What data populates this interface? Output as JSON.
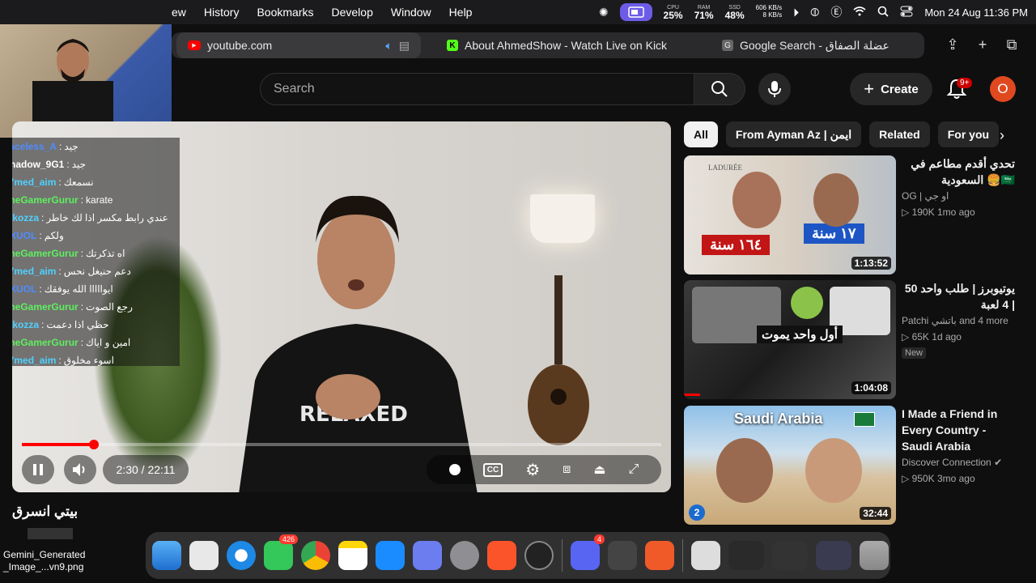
{
  "menubar": {
    "menus": [
      "ew",
      "History",
      "Bookmarks",
      "Develop",
      "Window",
      "Help"
    ],
    "cpu_label": "CPU",
    "cpu_value": "25%",
    "ram_label": "RAM",
    "ram_value": "71%",
    "ssd_label": "SSD",
    "ssd_value": "48%",
    "net_up": "606 KB/s",
    "net_down": "8 KB/s",
    "clock": "Mon 24 Aug  11:36 PM"
  },
  "tabs": [
    {
      "label": "youtube.com"
    },
    {
      "label": "About AhmedShow - Watch Live on Kick"
    },
    {
      "label": "Google Search - عضلة الصفاق"
    }
  ],
  "header": {
    "search_placeholder": "Search",
    "create_label": "Create",
    "notif_count": "9+",
    "avatar_letter": "O"
  },
  "chat": [
    {
      "user": "Faceless_A",
      "msg": "جيد",
      "color": "#4f8bff"
    },
    {
      "user": "Shadow_9G1",
      "msg": "جيد",
      "color": "#ffffff"
    },
    {
      "user": "a7med_aim",
      "msg": "نسمعك",
      "color": "#4fd0ff"
    },
    {
      "user": "TheGamerGurur",
      "msg": "karate",
      "color": "#5ef05e"
    },
    {
      "user": "rakozza",
      "msg": "عندي رابط مكسر اذا لك خاطر",
      "color": "#4fd0ff"
    },
    {
      "user": "EXUOL",
      "msg": "ولكم",
      "color": "#4f8bff"
    },
    {
      "user": "TheGamerGurur",
      "msg": "اه تذكرتك",
      "color": "#5ef05e"
    },
    {
      "user": "a7med_aim",
      "msg": "دعم حنيغل نحس",
      "color": "#4fd0ff"
    },
    {
      "user": "EXUOL",
      "msg": "ايوااااا الله يوفقك",
      "color": "#4f8bff"
    },
    {
      "user": "TheGamerGurur",
      "msg": "رجع الصوت",
      "color": "#5ef05e"
    },
    {
      "user": "rakozza",
      "msg": "حظي اذا دعمت",
      "color": "#4fd0ff"
    },
    {
      "user": "TheGamerGurur",
      "msg": "امين و اياك",
      "color": "#5ef05e"
    },
    {
      "user": "a7med_aim",
      "msg": "اسوء مخلوق",
      "color": "#4fd0ff"
    }
  ],
  "player": {
    "time": "2:30 / 22:11",
    "progress": 0.113,
    "caption": "بيتي انسرق"
  },
  "chips": [
    "All",
    "From Ayman Az | ايمن",
    "Related",
    "For you"
  ],
  "recommendations": [
    {
      "title": "تحدي أقدم مطاعم في السعودية 🍔🇸🇦",
      "channel": "OG | او جي",
      "views": "190K",
      "age": "1mo ago",
      "duration": "1:13:52",
      "thumb_text_left": "١٦٤ سنة",
      "thumb_text_right": "١٧ سنة",
      "thumb_brand": "LADURÉE"
    },
    {
      "title": "50 يوتيوبرز | طلب واحد | 4 لعبة",
      "channel": "Patchi باتشي and 4 more",
      "views": "65K",
      "age": "1d ago",
      "badge": "New",
      "duration": "1:04:08",
      "thumb_text": "أول واحد يموت"
    },
    {
      "title": "I Made a Friend in Every Country - Saudi Arabia",
      "channel": "Discover Connection",
      "views": "950K",
      "age": "3mo ago",
      "duration": "32:44",
      "thumb_text": "Saudi Arabia",
      "thumb_num": "2"
    }
  ],
  "dock": {
    "messages_badge": "426",
    "discord_badge": "4",
    "desktop_file": "Gemini_Generated _Image_...vn9.png"
  }
}
